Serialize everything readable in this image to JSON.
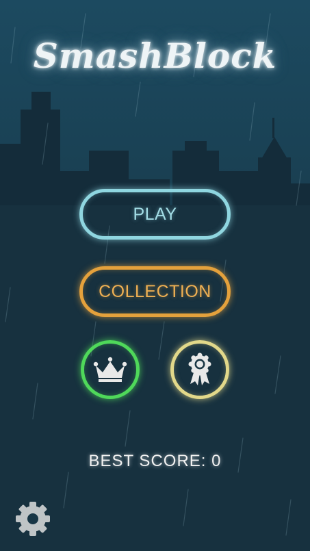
{
  "game": {
    "title": "SmashBlock"
  },
  "menu": {
    "play_label": "PLAY",
    "collection_label": "COLLECTION",
    "leaderboard_icon": "crown-icon",
    "achievements_icon": "ribbon-badge-icon",
    "settings_icon": "gear-icon"
  },
  "score": {
    "best_label": "BEST SCORE:",
    "best_value": "0"
  },
  "colors": {
    "play_accent": "#8fd6e0",
    "collection_accent": "#e4a13c",
    "leaderboard_accent": "#4fd85a",
    "achievements_accent": "#e2d88a"
  }
}
